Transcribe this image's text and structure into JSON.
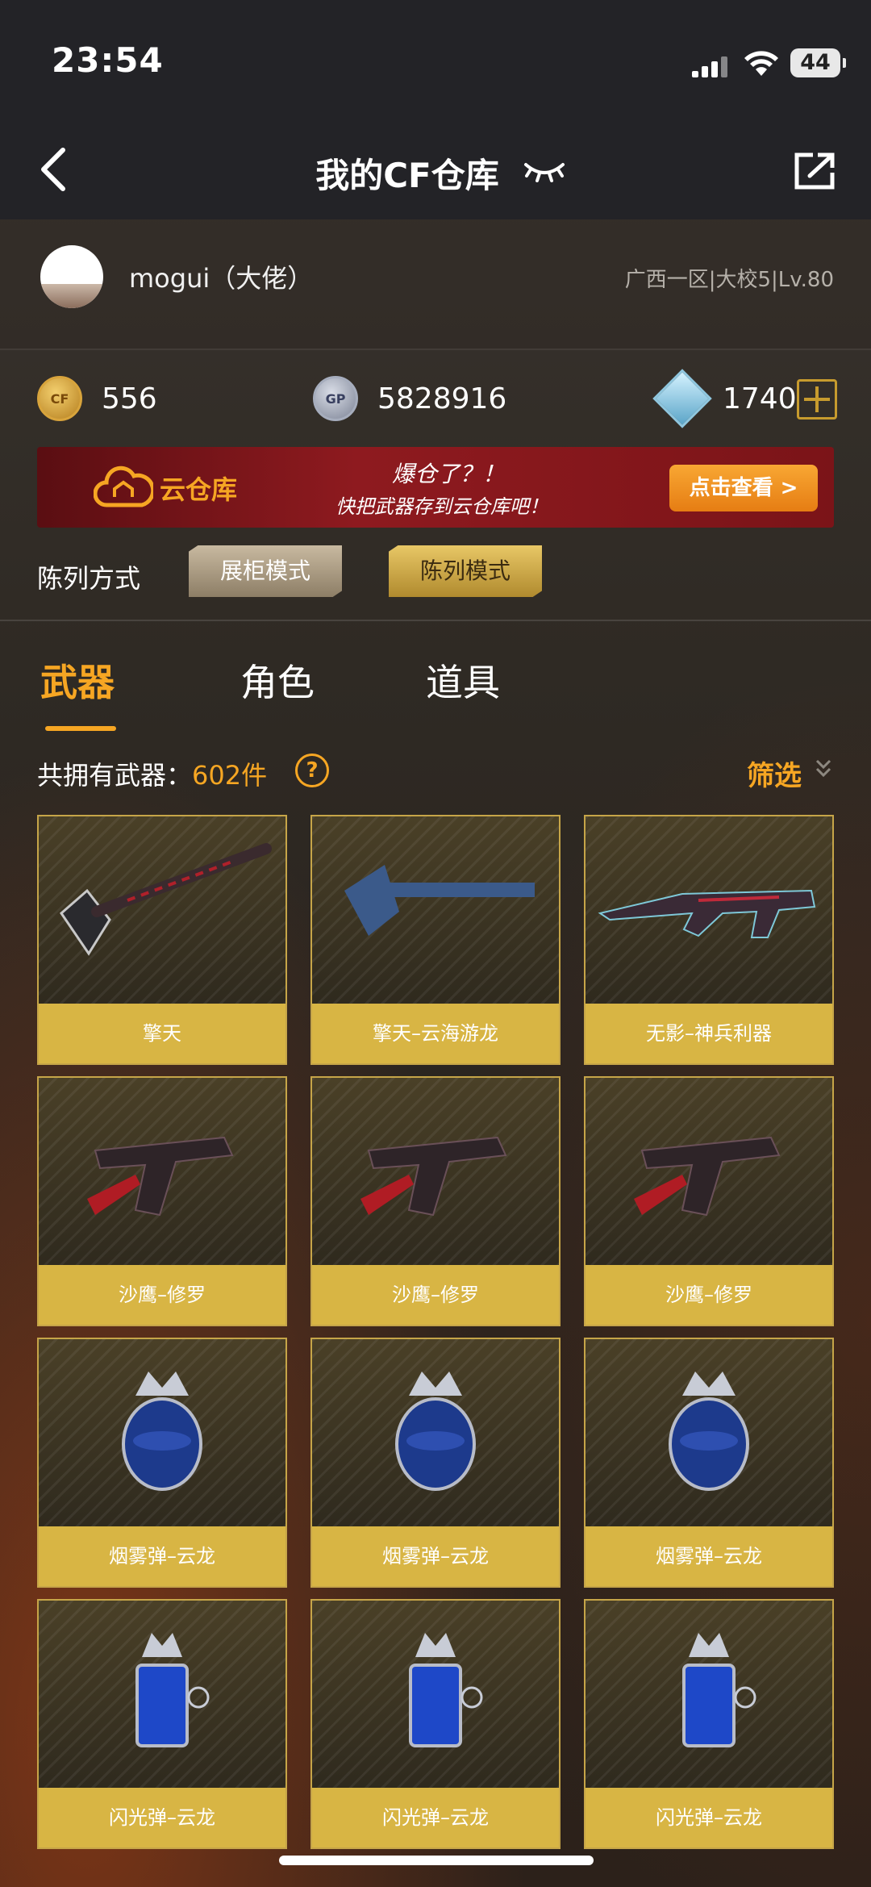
{
  "status_bar": {
    "time": "23:54",
    "battery": "44"
  },
  "nav": {
    "title": "我的CF仓库"
  },
  "profile": {
    "username": "mogui（大佬）",
    "server_info": "广西一区|大校5|Lv.80"
  },
  "currencies": {
    "cf_points": "556",
    "gp": "5828916",
    "diamonds": "1740"
  },
  "banner": {
    "cloud_title": "云仓库",
    "slogan_line1": "爆仓了？！",
    "slogan_line2": "快把武器存到云仓库吧！",
    "button_label": "点击查看 >"
  },
  "display": {
    "label": "陈列方式",
    "mode_cabinet": "展柜模式",
    "mode_display": "陈列模式"
  },
  "tabs": [
    "武器",
    "角色",
    "道具"
  ],
  "inventory": {
    "count_label": "共拥有武器：",
    "count_value": "602件",
    "filter_label": "筛选"
  },
  "items": [
    {
      "name": "擎天",
      "icon": "shovel-weapon-icon"
    },
    {
      "name": "擎天–云海游龙",
      "icon": "axe-weapon-icon"
    },
    {
      "name": "无影–神兵利器",
      "icon": "rifle-weapon-icon"
    },
    {
      "name": "沙鹰–修罗",
      "icon": "pistol-weapon-icon"
    },
    {
      "name": "沙鹰–修罗",
      "icon": "pistol-weapon-icon"
    },
    {
      "name": "沙鹰–修罗",
      "icon": "pistol-weapon-icon"
    },
    {
      "name": "烟雾弹–云龙",
      "icon": "smoke-grenade-icon"
    },
    {
      "name": "烟雾弹–云龙",
      "icon": "smoke-grenade-icon"
    },
    {
      "name": "烟雾弹–云龙",
      "icon": "smoke-grenade-icon"
    },
    {
      "name": "闪光弹–云龙",
      "icon": "flash-grenade-icon"
    },
    {
      "name": "闪光弹–云龙",
      "icon": "flash-grenade-icon"
    },
    {
      "name": "闪光弹–云龙",
      "icon": "flash-grenade-icon"
    }
  ],
  "colors": {
    "accent": "#f6a623",
    "card_label": "#d8b544",
    "banner_red": "#8e1a1f"
  }
}
